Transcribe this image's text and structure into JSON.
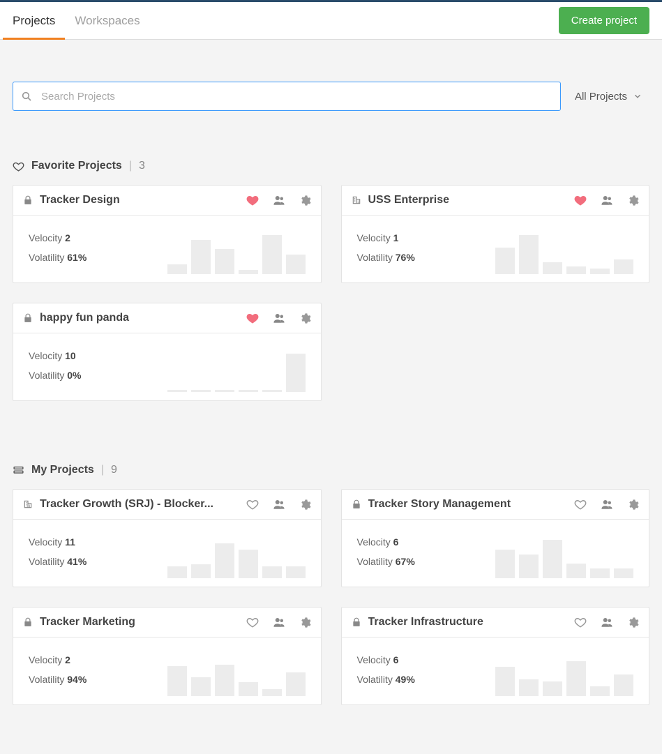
{
  "header": {
    "tabs": [
      {
        "label": "Projects",
        "active": true
      },
      {
        "label": "Workspaces",
        "active": false
      }
    ],
    "create_label": "Create project"
  },
  "search": {
    "placeholder": "Search Projects",
    "value": "",
    "filter_label": "All Projects"
  },
  "sections": {
    "favorites": {
      "title": "Favorite Projects",
      "count": "3"
    },
    "mine": {
      "title": "My Projects",
      "count": "9"
    }
  },
  "labels": {
    "velocity": "Velocity",
    "volatility": "Volatility"
  },
  "favorites": [
    {
      "name": "Tracker Design",
      "icon": "lock",
      "fav": true,
      "velocity": "2",
      "volatility": "61%",
      "bars": [
        20,
        70,
        52,
        8,
        80,
        40
      ]
    },
    {
      "name": "USS Enterprise",
      "icon": "building",
      "fav": true,
      "velocity": "1",
      "volatility": "76%",
      "bars": [
        55,
        80,
        25,
        16,
        12,
        30
      ]
    },
    {
      "name": "happy fun panda",
      "icon": "lock",
      "fav": true,
      "velocity": "10",
      "volatility": "0%",
      "bars": [
        5,
        5,
        5,
        5,
        5,
        78
      ]
    }
  ],
  "mine": [
    {
      "name": "Tracker Growth (SRJ) - Blocker...",
      "icon": "building",
      "fav": false,
      "velocity": "11",
      "volatility": "41%",
      "bars": [
        24,
        28,
        72,
        58,
        24,
        24
      ]
    },
    {
      "name": "Tracker Story Management",
      "icon": "lock",
      "fav": false,
      "velocity": "6",
      "volatility": "67%",
      "bars": [
        58,
        48,
        78,
        30,
        20,
        20
      ]
    },
    {
      "name": "Tracker Marketing",
      "icon": "lock",
      "fav": false,
      "velocity": "2",
      "volatility": "94%",
      "bars": [
        62,
        38,
        64,
        28,
        14,
        48
      ]
    },
    {
      "name": "Tracker Infrastructure",
      "icon": "lock",
      "fav": false,
      "velocity": "6",
      "volatility": "49%",
      "bars": [
        60,
        34,
        30,
        72,
        20,
        44
      ]
    }
  ]
}
